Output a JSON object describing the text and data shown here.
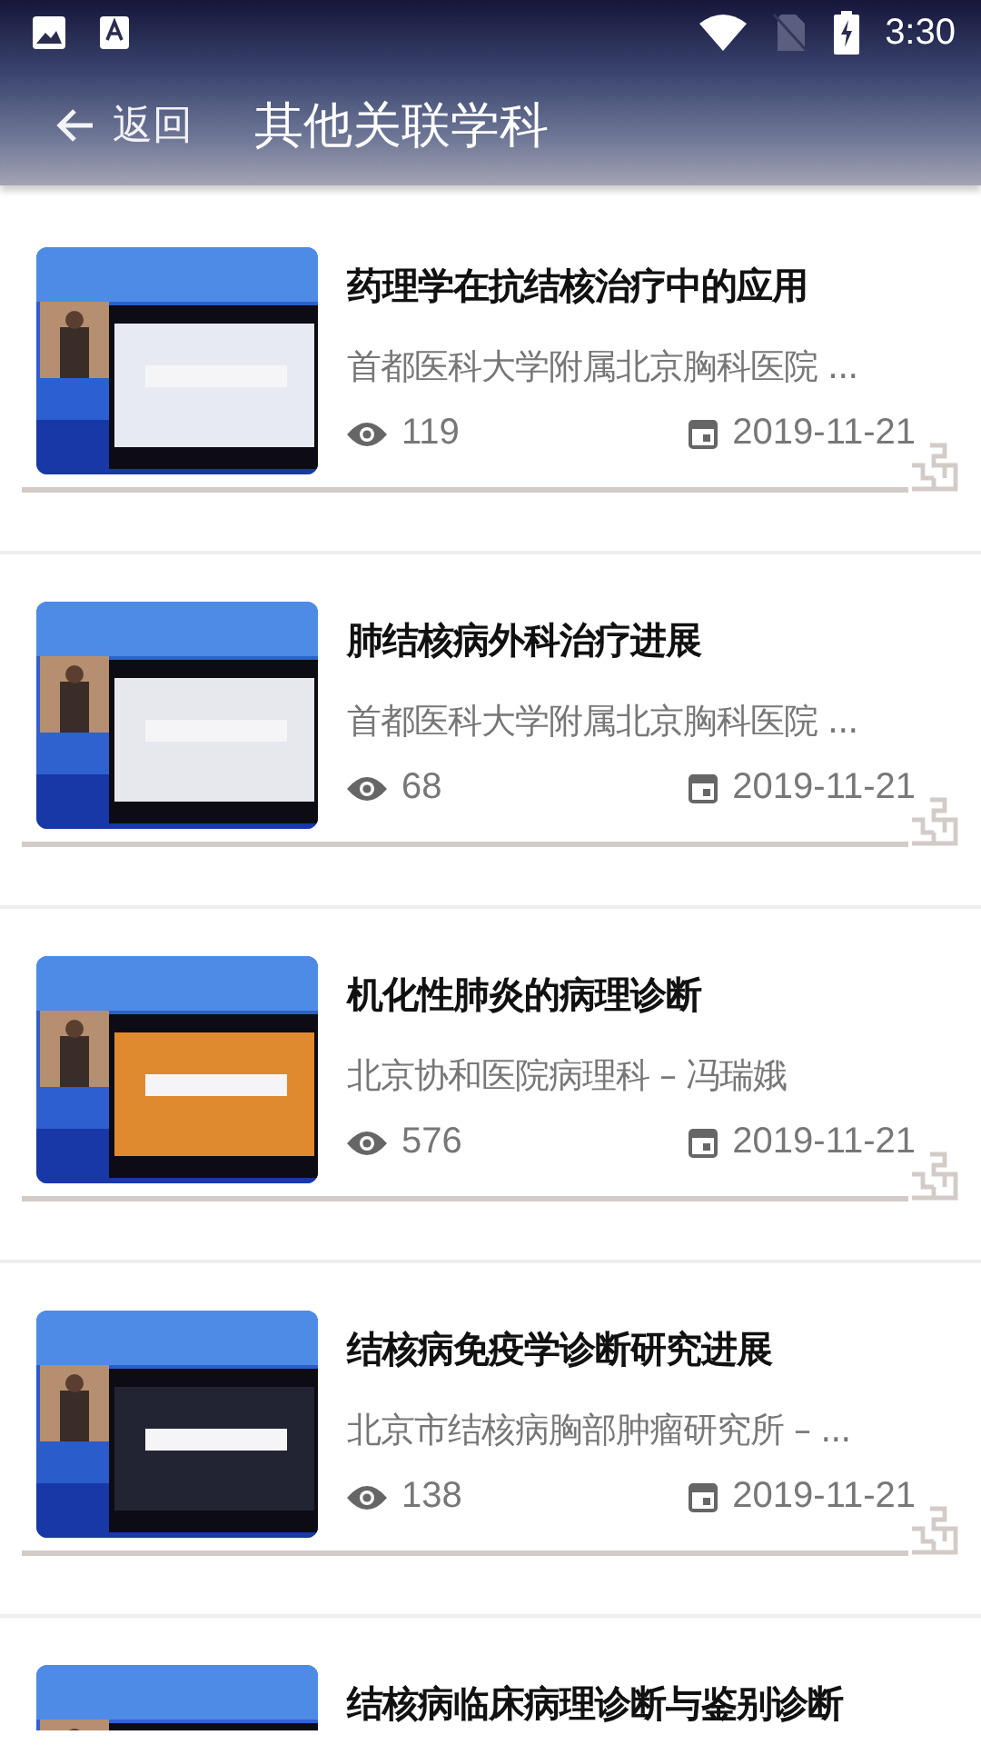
{
  "status_bar": {
    "time": "3:30"
  },
  "toolbar": {
    "back_label": "返回",
    "title": "其他关联学科"
  },
  "videos": [
    {
      "title": "药理学在抗结核治疗中的应用",
      "source": "首都医科大学附属北京胸科医院 ...",
      "views": "119",
      "date": "2019-11-21"
    },
    {
      "title": "肺结核病外科治疗进展",
      "source": "首都医科大学附属北京胸科医院 ...",
      "views": "68",
      "date": "2019-11-21"
    },
    {
      "title": "机化性肺炎的病理诊断",
      "source": "北京协和医院病理科 – 冯瑞娥",
      "views": "576",
      "date": "2019-11-21"
    },
    {
      "title": "结核病免疫学诊断研究进展",
      "source": "北京市结核病胸部肿瘤研究所 – ...",
      "views": "138",
      "date": "2019-11-21"
    },
    {
      "title": "结核病临床病理诊断与鉴别诊断"
    }
  ]
}
